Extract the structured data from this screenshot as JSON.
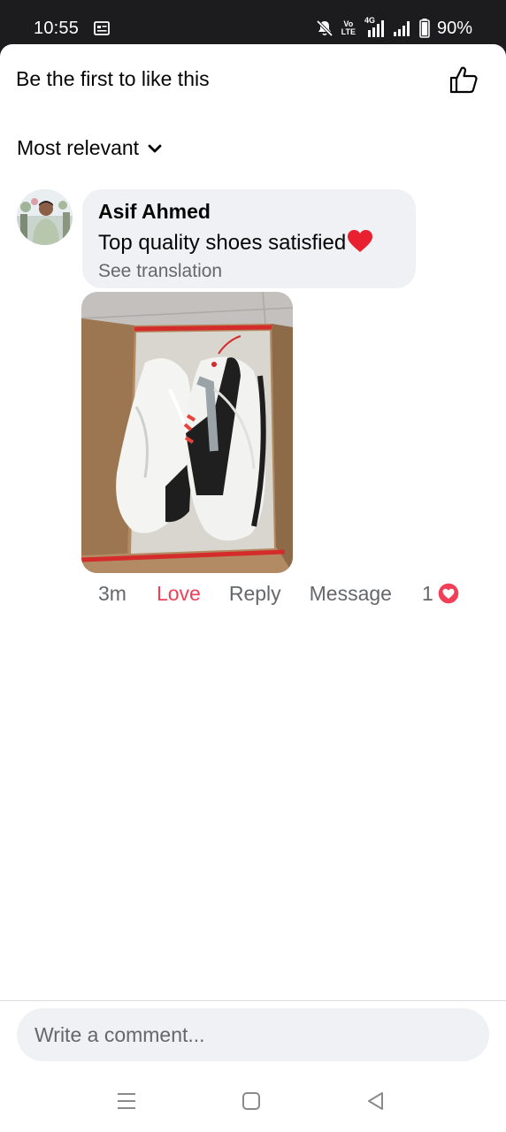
{
  "status_bar": {
    "time": "10:55",
    "volte_top": "Vo",
    "volte_bottom": "LTE",
    "network": "4G",
    "battery": "90%",
    "icons": [
      "notification-icon",
      "mute-icon",
      "volte-icon",
      "signal-icon",
      "battery-icon"
    ]
  },
  "header": {
    "likes_text": "Be the first to like this",
    "like_icon": "thumbs-up-icon"
  },
  "sort": {
    "label": "Most relevant",
    "icon": "chevron-down-icon"
  },
  "comment": {
    "author": "Asif Ahmed",
    "text": "Top quality shoes  satisfied",
    "emoji": "red-heart",
    "translation_link": "See translation",
    "photo": "white-sneakers-in-shoebox",
    "time": "3m",
    "reaction_label": "Love",
    "reply_label": "Reply",
    "message_label": "Message",
    "reaction_count": "1",
    "reaction_icon": "love-reaction-icon"
  },
  "composer": {
    "placeholder": "Write a comment..."
  },
  "nav": {
    "icons": [
      "recents-icon",
      "home-icon",
      "back-icon"
    ]
  },
  "colors": {
    "love": "#f33e58",
    "bubble": "#eff1f4",
    "secondary_text": "#65676b",
    "status_bar": "#1c1c1e"
  }
}
